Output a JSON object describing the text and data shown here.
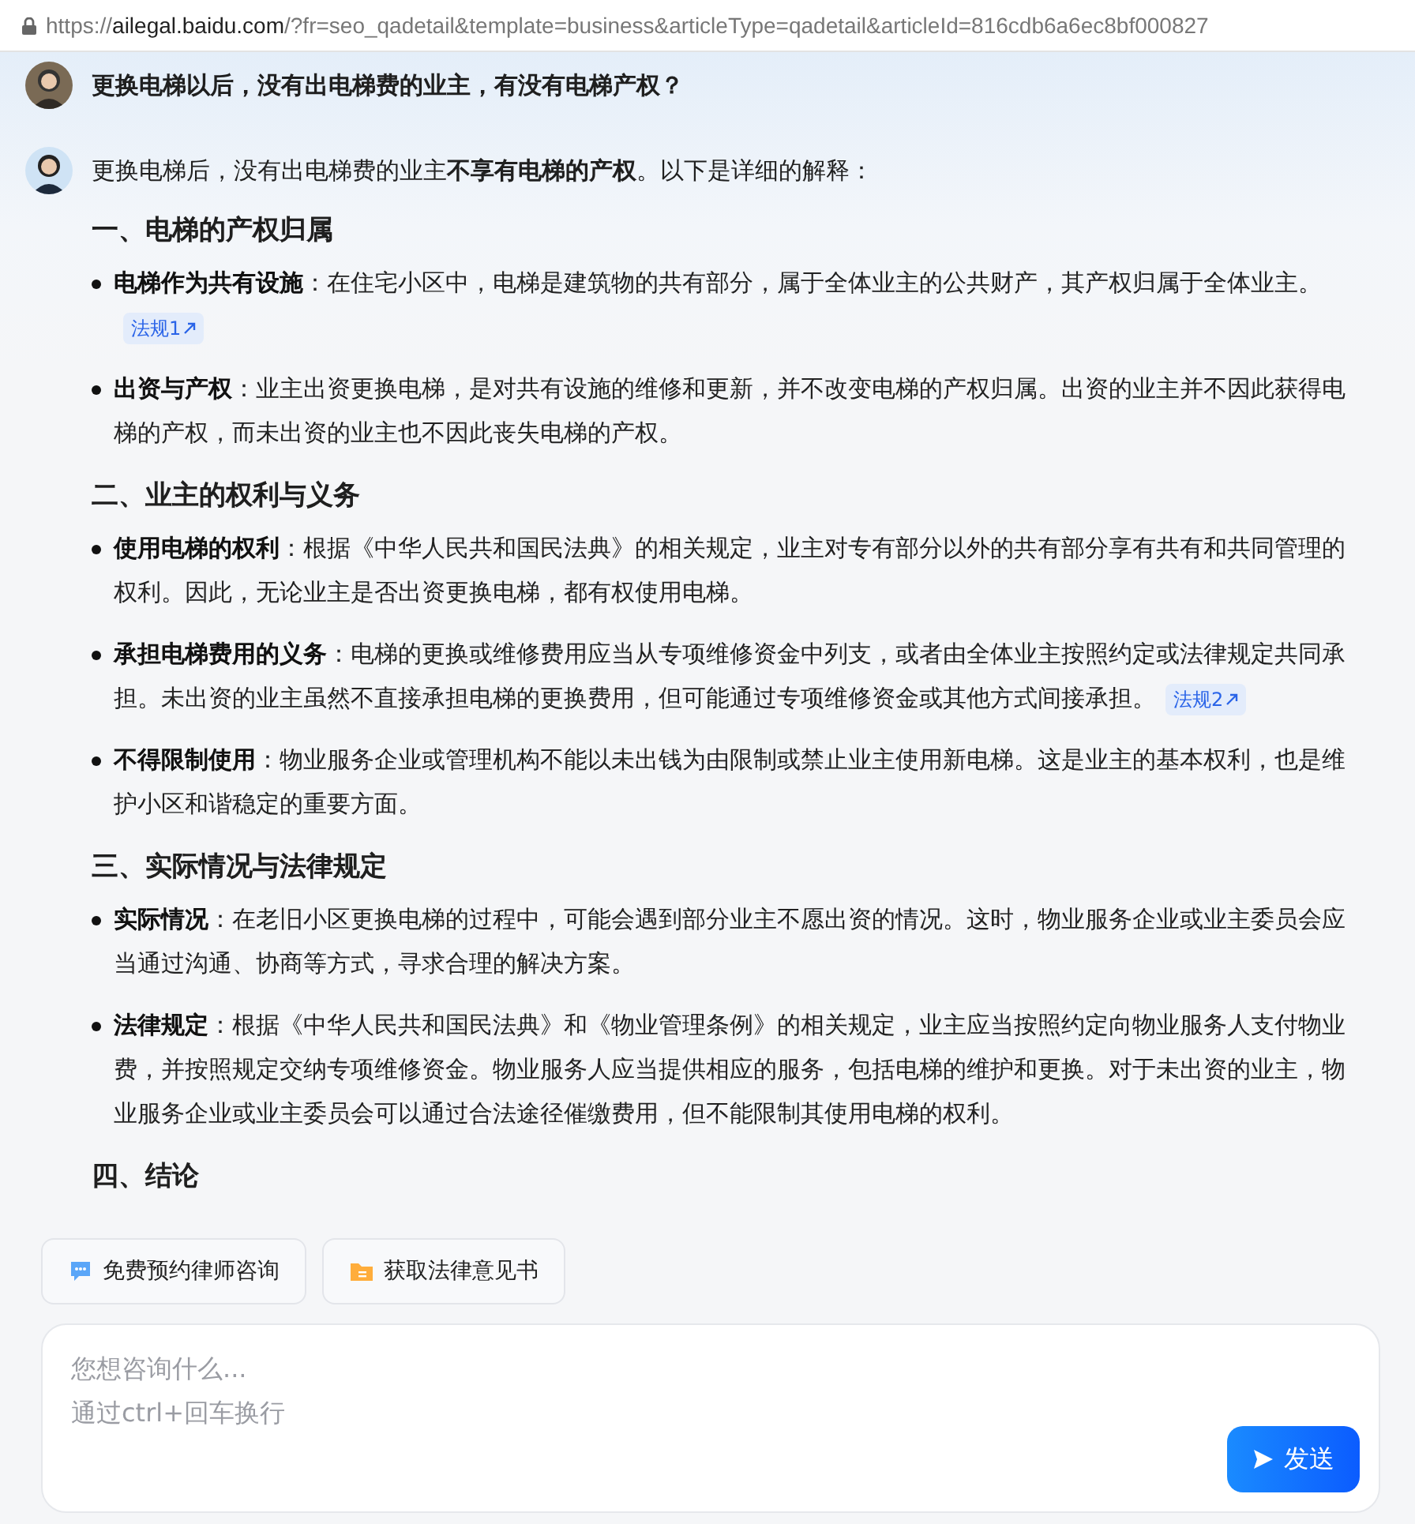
{
  "address_bar": {
    "scheme": "https://",
    "domain": "ailegal.baidu.com",
    "path": "/?fr=seo_qadetail&template=business&articleType=qadetail&articleId=816cdb6a6ec8bf000827"
  },
  "question": "更换电梯以后，没有出电梯费的业主，有没有电梯产权？",
  "answer": {
    "intro": "更换电梯后，没有出电梯费的业主**不享有电梯的产权**。以下是详细的解释：",
    "sections": [
      {
        "heading": "一、电梯的产权归属",
        "items": [
          {
            "term": "电梯作为共有设施",
            "text": "：在住宅小区中，电梯是建筑物的共有部分，属于全体业主的公共财产，其产权归属于全体业主。",
            "law": "法规1"
          },
          {
            "term": "出资与产权",
            "text": "：业主出资更换电梯，是对共有设施的维修和更新，并不改变电梯的产权归属。出资的业主并不因此获得电梯的产权，而未出资的业主也不因此丧失电梯的产权。"
          }
        ]
      },
      {
        "heading": "二、业主的权利与义务",
        "items": [
          {
            "term": "使用电梯的权利",
            "text": "：根据《中华人民共和国民法典》的相关规定，业主对专有部分以外的共有部分享有共有和共同管理的权利。因此，无论业主是否出资更换电梯，都有权使用电梯。"
          },
          {
            "term": "承担电梯费用的义务",
            "text": "：电梯的更换或维修费用应当从专项维修资金中列支，或者由全体业主按照约定或法律规定共同承担。未出资的业主虽然不直接承担电梯的更换费用，但可能通过专项维修资金或其他方式间接承担。",
            "law": "法规2"
          },
          {
            "term": "不得限制使用",
            "text": "：物业服务企业或管理机构不能以未出钱为由限制或禁止业主使用新电梯。这是业主的基本权利，也是维护小区和谐稳定的重要方面。"
          }
        ]
      },
      {
        "heading": "三、实际情况与法律规定",
        "items": [
          {
            "term": "实际情况",
            "text": "：在老旧小区更换电梯的过程中，可能会遇到部分业主不愿出资的情况。这时，物业服务企业或业主委员会应当通过沟通、协商等方式，寻求合理的解决方案。"
          },
          {
            "term": "法律规定",
            "text": "：根据《中华人民共和国民法典》和《物业管理条例》的相关规定，业主应当按照约定向物业服务人支付物业费，并按照规定交纳专项维修资金。物业服务人应当提供相应的服务，包括电梯的维护和更换。对于未出资的业主，物业服务企业或业主委员会可以通过合法途径催缴费用，但不能限制其使用电梯的权利。"
          }
        ]
      },
      {
        "heading": "四、结论"
      }
    ]
  },
  "actions": [
    {
      "kind": "chat",
      "label": "免费预约律师咨询"
    },
    {
      "kind": "doc",
      "label": "获取法律意见书"
    }
  ],
  "composer": {
    "placeholder": "您想咨询什么...\n通过ctrl+回车换行",
    "send": "发送"
  }
}
